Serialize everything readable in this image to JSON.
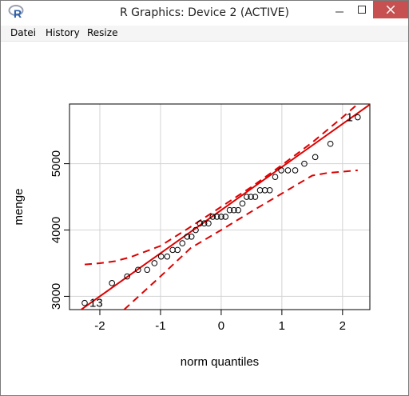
{
  "window": {
    "title": "R Graphics: Device 2 (ACTIVE)",
    "app_icon": "r-logo-icon",
    "accent_close": "#c75050"
  },
  "menu": {
    "items": [
      {
        "label": "Datei"
      },
      {
        "label": "History"
      },
      {
        "label": "Resize"
      }
    ]
  },
  "chart_data": {
    "type": "scatter",
    "title": "",
    "xlabel": "norm quantiles",
    "ylabel": "menge",
    "xlim": [
      -2.5,
      2.45
    ],
    "ylim": [
      2800,
      5900
    ],
    "xticks": [
      -2,
      -1,
      0,
      1,
      2
    ],
    "yticks": [
      3000,
      4000,
      5000
    ],
    "xtick_labels": [
      "-2",
      "-1",
      "0",
      "1",
      "2"
    ],
    "ytick_labels": [
      "3000",
      "4000",
      "5000"
    ],
    "grid": true,
    "points": [
      {
        "x": -2.25,
        "y": 2900
      },
      {
        "x": -1.8,
        "y": 3200
      },
      {
        "x": -1.55,
        "y": 3300
      },
      {
        "x": -1.37,
        "y": 3400
      },
      {
        "x": -1.22,
        "y": 3400
      },
      {
        "x": -1.1,
        "y": 3500
      },
      {
        "x": -0.99,
        "y": 3600
      },
      {
        "x": -0.89,
        "y": 3600
      },
      {
        "x": -0.8,
        "y": 3700
      },
      {
        "x": -0.72,
        "y": 3700
      },
      {
        "x": -0.64,
        "y": 3800
      },
      {
        "x": -0.56,
        "y": 3900
      },
      {
        "x": -0.49,
        "y": 3900
      },
      {
        "x": -0.42,
        "y": 4000
      },
      {
        "x": -0.35,
        "y": 4100
      },
      {
        "x": -0.28,
        "y": 4100
      },
      {
        "x": -0.21,
        "y": 4100
      },
      {
        "x": -0.14,
        "y": 4200
      },
      {
        "x": -0.07,
        "y": 4200
      },
      {
        "x": 0.0,
        "y": 4200
      },
      {
        "x": 0.07,
        "y": 4200
      },
      {
        "x": 0.14,
        "y": 4300
      },
      {
        "x": 0.21,
        "y": 4300
      },
      {
        "x": 0.28,
        "y": 4300
      },
      {
        "x": 0.35,
        "y": 4400
      },
      {
        "x": 0.42,
        "y": 4500
      },
      {
        "x": 0.49,
        "y": 4500
      },
      {
        "x": 0.56,
        "y": 4500
      },
      {
        "x": 0.64,
        "y": 4600
      },
      {
        "x": 0.72,
        "y": 4600
      },
      {
        "x": 0.8,
        "y": 4600
      },
      {
        "x": 0.89,
        "y": 4800
      },
      {
        "x": 0.99,
        "y": 4900
      },
      {
        "x": 1.1,
        "y": 4900
      },
      {
        "x": 1.22,
        "y": 4900
      },
      {
        "x": 1.37,
        "y": 5000
      },
      {
        "x": 1.55,
        "y": 5100
      },
      {
        "x": 1.8,
        "y": 5300
      },
      {
        "x": 2.25,
        "y": 5700
      }
    ],
    "point_labels": [
      {
        "text": "1",
        "x": 2.25,
        "y": 5700,
        "side": "left"
      },
      {
        "text": "13",
        "x": -2.25,
        "y": 2900,
        "side": "right"
      }
    ],
    "reference_line": {
      "color": "#dd0000",
      "intercept": 4300,
      "slope": 650
    },
    "envelope": {
      "color": "#dd0000",
      "upper": [
        [
          -2.25,
          3480
        ],
        [
          -2.0,
          3500
        ],
        [
          -1.75,
          3530
        ],
        [
          -1.5,
          3590
        ],
        [
          -1.0,
          3760
        ],
        [
          -0.5,
          4050
        ],
        [
          0.0,
          4350
        ],
        [
          0.5,
          4650
        ],
        [
          1.0,
          4980
        ],
        [
          1.5,
          5320
        ],
        [
          2.0,
          5700
        ],
        [
          2.25,
          5900
        ]
      ],
      "lower": [
        [
          -1.6,
          2800
        ],
        [
          -1.0,
          3300
        ],
        [
          -0.5,
          3730
        ],
        [
          0.0,
          4000
        ],
        [
          0.5,
          4280
        ],
        [
          1.0,
          4550
        ],
        [
          1.5,
          4820
        ],
        [
          1.75,
          4860
        ],
        [
          2.0,
          4880
        ],
        [
          2.25,
          4900
        ]
      ]
    }
  }
}
